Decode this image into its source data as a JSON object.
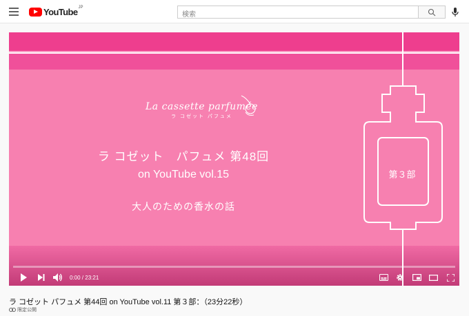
{
  "header": {
    "logo_text": "YouTube",
    "logo_region": "JP",
    "search_placeholder": "検索",
    "icons": [
      "menu-icon",
      "search-icon",
      "mic-icon"
    ]
  },
  "video_frame": {
    "brand_script": "La cassette parfumée",
    "brand_kana": "ラ コゼット パフュメ",
    "title_line1": "ラ コゼット　パフュメ 第48回",
    "title_line2": "on YouTube vol.15",
    "subtitle": "大人のための香水の話",
    "part_label": "第３部",
    "colors": {
      "base": "#f780b0",
      "band": "#ee3e8e",
      "band_deep": "#f0509a",
      "line": "#ffffff"
    }
  },
  "player": {
    "current_time": "0:00",
    "separator": " / ",
    "duration": "23:21",
    "progress": 0,
    "icons": [
      "play-icon",
      "next-icon",
      "volume-icon",
      "subtitles-icon",
      "settings-icon",
      "miniplayer-icon",
      "theater-icon",
      "fullscreen-icon"
    ]
  },
  "video": {
    "title": "ラ コゼット パフュメ 第44回 on YouTube vol.11 第３部：（23分22秒）",
    "privacy_label": "限定公開"
  }
}
